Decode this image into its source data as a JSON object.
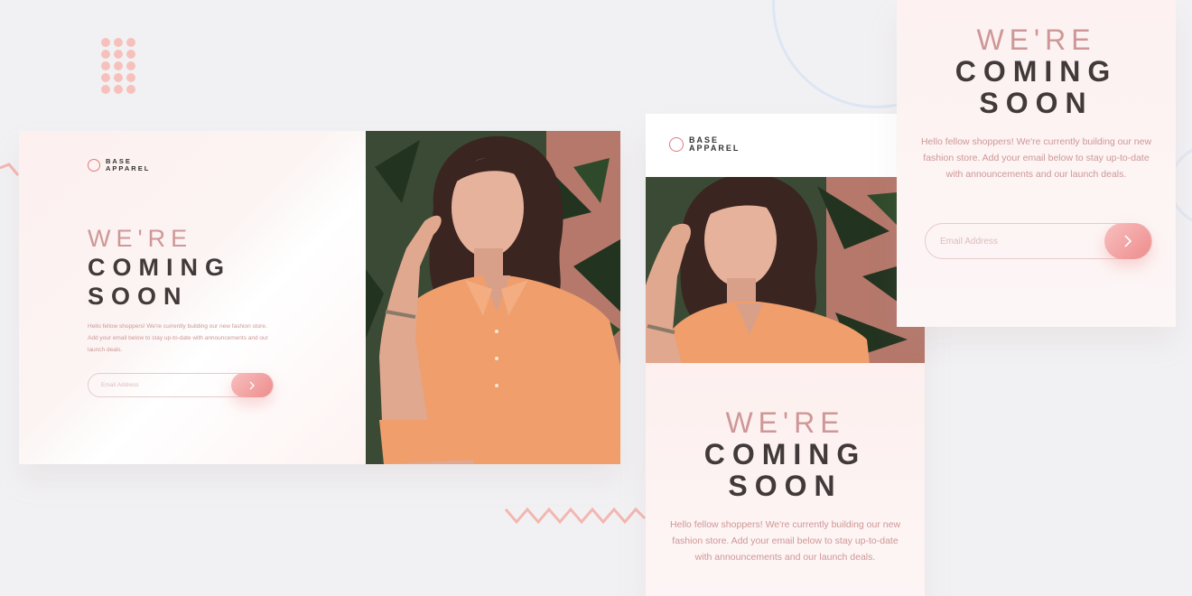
{
  "brand": {
    "line1": "BASE",
    "line2": "APPAREL"
  },
  "hero": {
    "title_light": "WE'RE",
    "title_bold_1": "COMING",
    "title_bold_2": "SOON",
    "body": "Hello fellow shoppers! We're currently building our new fashion store. Add your email below to stay up-to-date with announcements and our launch deals."
  },
  "form": {
    "placeholder": "Email Address",
    "submit_icon": "chevron-right-icon"
  },
  "colors": {
    "accent": "#ce9797",
    "button": "#ee8c8c",
    "dark": "#423a3a"
  }
}
